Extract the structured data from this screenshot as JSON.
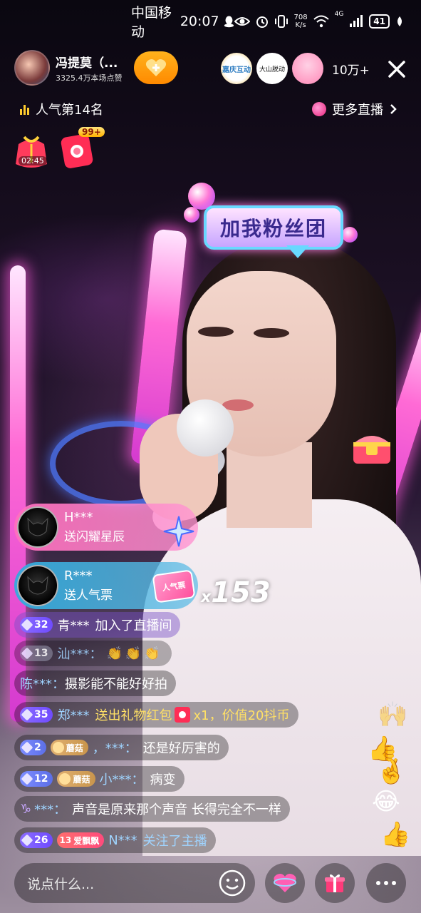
{
  "status_bar": {
    "carrier": "中国移动",
    "time": "20:07",
    "net_speed_value": "708",
    "net_speed_unit": "K/s",
    "network": "4G",
    "battery": "41"
  },
  "header": {
    "host_name": "冯提莫（...",
    "host_likes": "3325.4万本场点赞",
    "viewer_count": "10万+",
    "viewer_avatar_labels": [
      "嘉庆互动",
      "大山脱动"
    ],
    "rank": "人气第14名",
    "more_live": "更多直播"
  },
  "activity": {
    "gift_timer": "02:45",
    "redpacket_badge": "99+"
  },
  "sticker": {
    "fan_club": "加我粉丝团"
  },
  "gift_notices": [
    {
      "user": "H***",
      "action": "送闪耀星辰"
    },
    {
      "user": "R***",
      "action": "送人气票",
      "item_label": "人气票"
    }
  ],
  "combo": {
    "prefix": "x",
    "count": "153"
  },
  "chat": [
    {
      "level": "32",
      "name": "青***",
      "text": "加入了直播间"
    },
    {
      "level": "13",
      "name": "汕***：",
      "text": "👏👏👏"
    },
    {
      "name": "陈***：",
      "text": "摄影能不能好好拍"
    },
    {
      "level": "35",
      "name": "郑***",
      "text": "送出礼物红包",
      "text2": "x1，价值20抖币"
    },
    {
      "level": "2",
      "fan": "蘑菇",
      "name": "，***：",
      "text": "还是好厉害的"
    },
    {
      "level": "12",
      "fan": "蘑菇",
      "name": "小***：",
      "text": "病变"
    },
    {
      "zodiac": "♑",
      "name": "***：",
      "text": "声音是原来那个声音 长得完全不一样"
    },
    {
      "level": "26",
      "fan_level": "13",
      "fan": "爱飘飘",
      "name": "N***",
      "text": "关注了主播"
    }
  ],
  "bottom": {
    "comment_placeholder": "说点什么..."
  },
  "colors": {
    "follow_orange": "#ff8a00",
    "neon_pink": "#ff6ad5",
    "level_purple": "#6f4bff",
    "chat_bubble": "rgba(0,0,0,0.32)",
    "name_blue": "#9fd4ff",
    "gift_yellow": "#ffe066"
  }
}
